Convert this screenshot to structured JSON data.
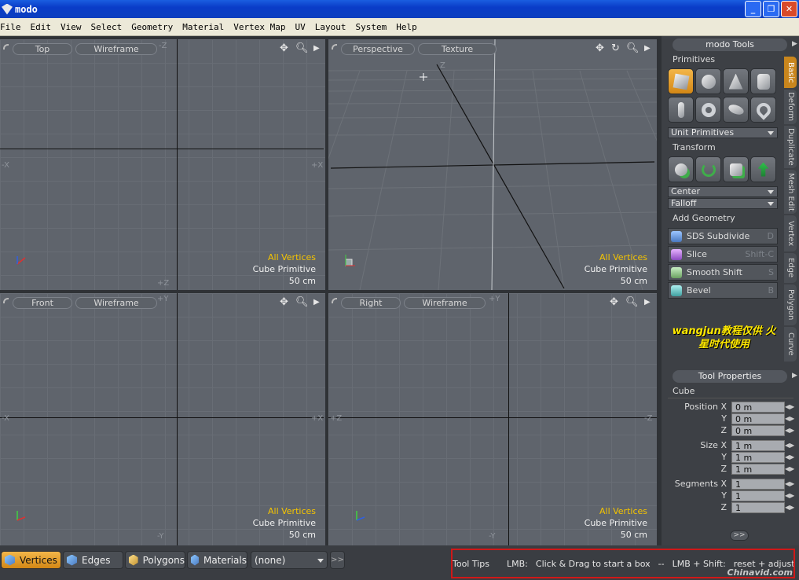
{
  "window": {
    "title": "modo"
  },
  "menu": [
    "File",
    "Edit",
    "View",
    "Select",
    "Geometry",
    "Material",
    "Vertex Map",
    "UV",
    "Layout",
    "System",
    "Help"
  ],
  "viewports": [
    {
      "id": "top",
      "view": "Top",
      "mode": "Wireframe",
      "info": [
        "All Vertices",
        "Cube Primitive",
        "50 cm"
      ],
      "axes": {
        "top": "-Z",
        "bottom": "+Z",
        "left": "-X",
        "right": "+X"
      }
    },
    {
      "id": "persp",
      "view": "Perspective",
      "mode": "Texture",
      "info": [
        "All Vertices",
        "Cube Primitive",
        "50 cm"
      ],
      "axes": {
        "top": "Z"
      }
    },
    {
      "id": "front",
      "view": "Front",
      "mode": "Wireframe",
      "info": [
        "All Vertices",
        "Cube Primitive",
        "50 cm"
      ],
      "axes": {
        "top": "+Y",
        "bottom": "-Y",
        "left": "-X",
        "right": "+X"
      }
    },
    {
      "id": "right",
      "view": "Right",
      "mode": "Wireframe",
      "info": [
        "All Vertices",
        "Cube Primitive",
        "50 cm"
      ],
      "axes": {
        "top": "+Y",
        "bottom": "-Y",
        "left": "+Z",
        "right": "-Z"
      }
    }
  ],
  "tools": {
    "header": "modo Tools",
    "primitives_label": "Primitives",
    "primitives_dropdown": "Unit Primitives",
    "transform_label": "Transform",
    "center_dropdown": "Center",
    "falloff_dropdown": "Falloff",
    "add_geometry_label": "Add Geometry",
    "geometry": [
      {
        "label": "SDS Subdivide",
        "key": "D"
      },
      {
        "label": "Slice",
        "key": "Shift-C"
      },
      {
        "label": "Smooth Shift",
        "key": "S"
      },
      {
        "label": "Bevel",
        "key": "B"
      }
    ],
    "tabs": [
      "Basic",
      "Deform",
      "Duplicate",
      "Mesh Edit",
      "Vertex",
      "Edge",
      "Polygon",
      "Curve"
    ],
    "watermark": "wangjun教程仅供 火星时代使用"
  },
  "properties": {
    "header": "Tool Properties",
    "section": "Cube",
    "position_label": "Position",
    "size_label": "Size",
    "segments_label": "Segments",
    "position": {
      "x": "0 m",
      "y": "0 m",
      "z": "0 m"
    },
    "size": {
      "x": "1 m",
      "y": "1 m",
      "z": "1 m"
    },
    "segments": {
      "x": "1",
      "y": "1",
      "z": "1"
    },
    "axis": {
      "x": "X",
      "y": "Y",
      "z": "Z"
    },
    "more_button": ">>"
  },
  "modes": {
    "vertices": "Vertices",
    "edges": "Edges",
    "polygons": "Polygons",
    "materials": "Materials",
    "selection": "(none)",
    "more": ">>"
  },
  "tooltips": {
    "label": "Tool Tips",
    "lmb": "LMB:",
    "lmb_action": "Click & Drag to start a box",
    "separator": "--",
    "shift": "LMB + Shift:",
    "shift_action": "reset + adjust handle ..."
  },
  "site_watermark": "Chinavid.com"
}
